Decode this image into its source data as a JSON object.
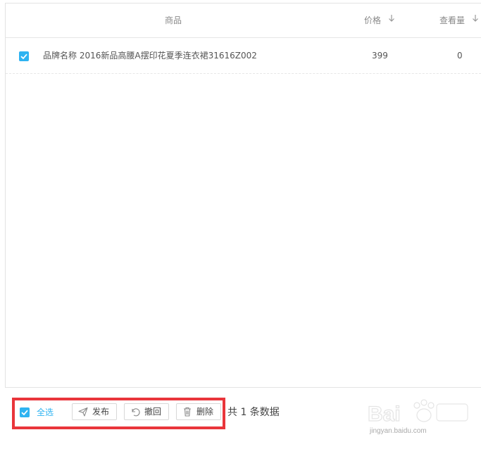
{
  "table": {
    "headers": {
      "product": "商品",
      "price": "价格",
      "views": "查看量"
    },
    "rows": [
      {
        "checked": true,
        "name": "品牌名称 2016新品高腰A摆印花夏季连衣裙31616Z002",
        "price": "399",
        "views": "0"
      }
    ]
  },
  "footer": {
    "select_all_label": "全选",
    "publish_label": "发布",
    "revoke_label": "撤回",
    "delete_label": "删除",
    "total_text": "共 1 条数据"
  },
  "watermark": {
    "text": "jingyan.baidu.com"
  },
  "colors": {
    "accent": "#2fb3f1",
    "highlight_box": "#e9353b"
  },
  "icons": [
    "sort-down-icon",
    "check-icon",
    "send-icon",
    "undo-icon",
    "trash-icon"
  ]
}
